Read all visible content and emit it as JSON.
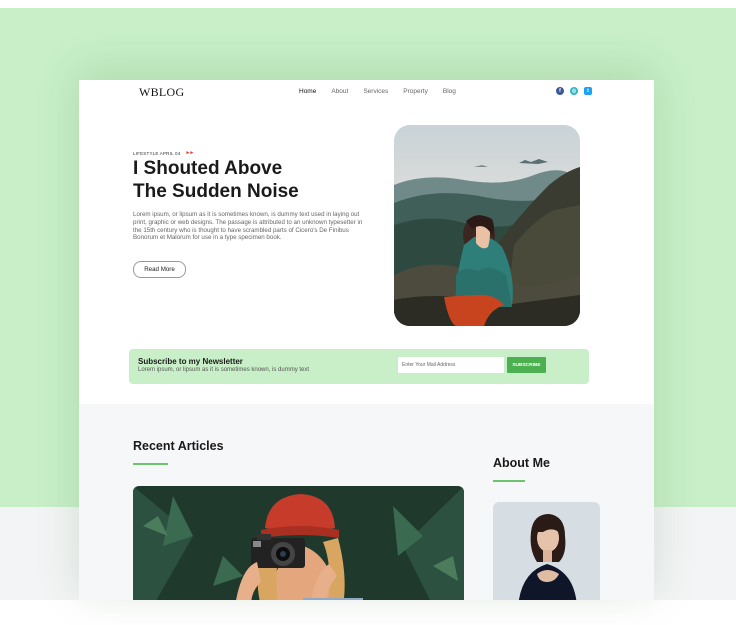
{
  "header": {
    "logo": "WBLOG",
    "nav": [
      "Home",
      "About",
      "Services",
      "Property",
      "Blog"
    ],
    "social_icons": [
      "facebook-icon",
      "instagram-icon",
      "twitter-icon"
    ]
  },
  "hero": {
    "eyebrow": "LIFESTYLE APRIL 04",
    "title_line1": "I Shouted Above",
    "title_line2": "The Sudden Noise",
    "text": "Lorem ipsum, or lipsum as it is sometimes known, is dummy text used in laying out print, graphic or web designs. The passage is attributed to an unknown typesetter in the 15th century who is thought to have scrambled parts of Cicero's De Finibus Bonorum et Malorum for use in a type specimen book.",
    "button": "Read More"
  },
  "newsletter": {
    "title": "Subscribe to my Newsletter",
    "subtitle": "Lorem ipsum, or lipsum as it is sometimes known, is dummy text",
    "placeholder": "Enter Your Mail Address",
    "button": "SUBSCRIBE"
  },
  "recent": {
    "title": "Recent Articles"
  },
  "about": {
    "title": "About Me"
  },
  "colors": {
    "accent": "#4caf50",
    "mint": "#c8efc8",
    "arrow": "#e53935"
  }
}
